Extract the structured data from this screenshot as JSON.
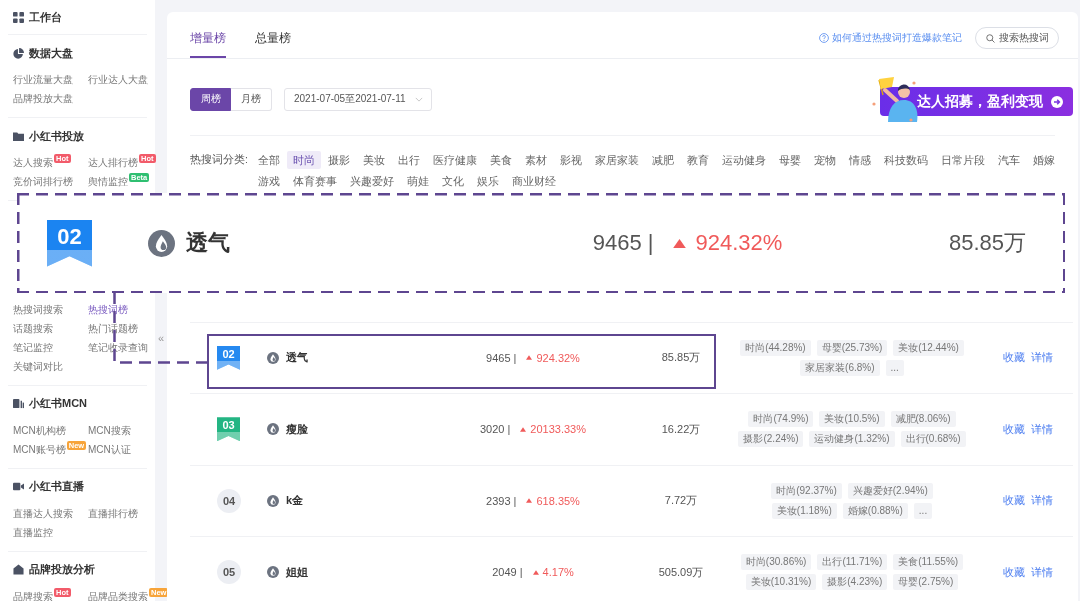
{
  "sidebar": {
    "sections": [
      {
        "title": "工作台"
      },
      {
        "title": "数据大盘",
        "items": [
          {
            "label": "行业流量大盘",
            "selected": false
          },
          {
            "label": "行业达人大盘",
            "selected": false
          },
          {
            "label": "品牌投放大盘",
            "selected": false
          }
        ]
      },
      {
        "title": "小红书投放",
        "items": [
          {
            "label": "达人搜索",
            "selected": false,
            "badge": {
              "text": "Hot",
              "color": "#f25b6a"
            }
          },
          {
            "label": "达人排行榜",
            "selected": false,
            "badge": {
              "text": "Hot",
              "color": "#f25b6a"
            }
          },
          {
            "label": "竞价词排行榜",
            "selected": false
          },
          {
            "label": "舆情监控",
            "selected": false,
            "badge": {
              "text": "Beta",
              "color": "#2fbf71"
            }
          }
        ]
      },
      {
        "items": [
          {
            "label": "热搜词搜索",
            "selected": false
          },
          {
            "label": "热搜词榜",
            "selected": true
          },
          {
            "label": "话题搜索",
            "selected": false
          },
          {
            "label": "热门话题榜",
            "selected": false
          },
          {
            "label": "笔记监控",
            "selected": false
          },
          {
            "label": "笔记收录查询",
            "selected": false
          },
          {
            "label": "关键词对比",
            "selected": false
          }
        ]
      },
      {
        "title": "小红书MCN",
        "items": [
          {
            "label": "MCN机构榜",
            "selected": false
          },
          {
            "label": "MCN搜索",
            "selected": false
          },
          {
            "label": "MCN账号榜",
            "selected": false,
            "badge": {
              "text": "New",
              "color": "#f7a43a"
            }
          },
          {
            "label": "MCN认证",
            "selected": false
          }
        ]
      },
      {
        "title": "小红书直播",
        "items": [
          {
            "label": "直播达人搜索",
            "selected": false
          },
          {
            "label": "直播排行榜",
            "selected": false
          },
          {
            "label": "直播监控",
            "selected": false
          }
        ]
      },
      {
        "title": "品牌投放分析",
        "items": [
          {
            "label": "品牌搜索",
            "selected": false,
            "badge": {
              "text": "Hot",
              "color": "#f25b6a"
            }
          },
          {
            "label": "品牌品类搜索",
            "selected": false,
            "badge": {
              "text": "New",
              "color": "#f7a43a"
            }
          }
        ]
      }
    ],
    "collapse_button": "«"
  },
  "header": {
    "tabs": [
      {
        "label": "增量榜",
        "selected": true
      },
      {
        "label": "总量榜",
        "selected": false
      }
    ],
    "help_link": "如何通过热搜词打造爆款笔记",
    "search_button": "搜索热搜词"
  },
  "toolbar": {
    "period_toggle": [
      {
        "label": "周榜",
        "selected": true
      },
      {
        "label": "月榜",
        "selected": false
      }
    ],
    "date_range": "2021-07-05至2021-07-11",
    "banner": "达人招募，盈利变现"
  },
  "category_filter": {
    "label": "热搜词分类:",
    "options": [
      {
        "label": "全部",
        "selected": false
      },
      {
        "label": "时尚",
        "selected": true
      },
      {
        "label": "摄影",
        "selected": false
      },
      {
        "label": "美妆",
        "selected": false
      },
      {
        "label": "出行",
        "selected": false
      },
      {
        "label": "医疗健康",
        "selected": false
      },
      {
        "label": "美食",
        "selected": false
      },
      {
        "label": "素材",
        "selected": false
      },
      {
        "label": "影视",
        "selected": false
      },
      {
        "label": "家居家装",
        "selected": false
      },
      {
        "label": "减肥",
        "selected": false
      },
      {
        "label": "教育",
        "selected": false
      },
      {
        "label": "运动健身",
        "selected": false
      },
      {
        "label": "母婴",
        "selected": false
      },
      {
        "label": "宠物",
        "selected": false
      },
      {
        "label": "情感",
        "selected": false
      },
      {
        "label": "科技数码",
        "selected": false
      },
      {
        "label": "日常片段",
        "selected": false
      },
      {
        "label": "汽车",
        "selected": false
      },
      {
        "label": "婚嫁",
        "selected": false
      },
      {
        "label": "游戏",
        "selected": false
      },
      {
        "label": "体育赛事",
        "selected": false
      },
      {
        "label": "兴趣爱好",
        "selected": false
      },
      {
        "label": "萌娃",
        "selected": false
      },
      {
        "label": "文化",
        "selected": false
      },
      {
        "label": "娱乐",
        "selected": false
      },
      {
        "label": "商业财经",
        "selected": false
      }
    ]
  },
  "callout": {
    "kind": "ribbon",
    "rank": "02",
    "color": "#1b84f1",
    "keyword": "透气",
    "count": "9465 |",
    "growth": "924.32%",
    "heat": "85.85万"
  },
  "rows": [
    {
      "kind": "ribbon",
      "rank": "02",
      "color": "#2589f0",
      "highlighted": true,
      "keyword": "透气",
      "count": "9465 |",
      "growth": "924.32%",
      "heat": "85.85万",
      "tags": [
        "时尚(44.28%)",
        "母婴(25.73%)",
        "美妆(12.44%)",
        "家居家装(6.8%)",
        "..."
      ],
      "actions": [
        "收藏",
        "详情"
      ]
    },
    {
      "kind": "ribbon",
      "rank": "03",
      "color": "#23b583",
      "highlighted": false,
      "keyword": "瘦脸",
      "count": "3020 |",
      "growth": "20133.33%",
      "heat": "16.22万",
      "tags": [
        "时尚(74.9%)",
        "美妆(10.5%)",
        "减肥(8.06%)",
        "摄影(2.24%)",
        "运动健身(1.32%)",
        "出行(0.68%)"
      ],
      "actions": [
        "收藏",
        "详情"
      ]
    },
    {
      "kind": "circle",
      "rank": "04",
      "highlighted": false,
      "keyword": "k金",
      "count": "2393 |",
      "growth": "618.35%",
      "heat": "7.72万",
      "tags": [
        "时尚(92.37%)",
        "兴趣爱好(2.94%)",
        "美妆(1.18%)",
        "婚嫁(0.88%)",
        "..."
      ],
      "actions": [
        "收藏",
        "详情"
      ]
    },
    {
      "kind": "circle",
      "rank": "05",
      "highlighted": false,
      "keyword": "姐姐",
      "count": "2049 |",
      "growth": "4.17%",
      "heat": "505.09万",
      "tags": [
        "时尚(30.86%)",
        "出行(11.71%)",
        "美食(11.55%)",
        "美妆(10.31%)",
        "摄影(4.23%)",
        "母婴(2.75%)"
      ],
      "actions": [
        "收藏",
        "详情"
      ]
    }
  ]
}
